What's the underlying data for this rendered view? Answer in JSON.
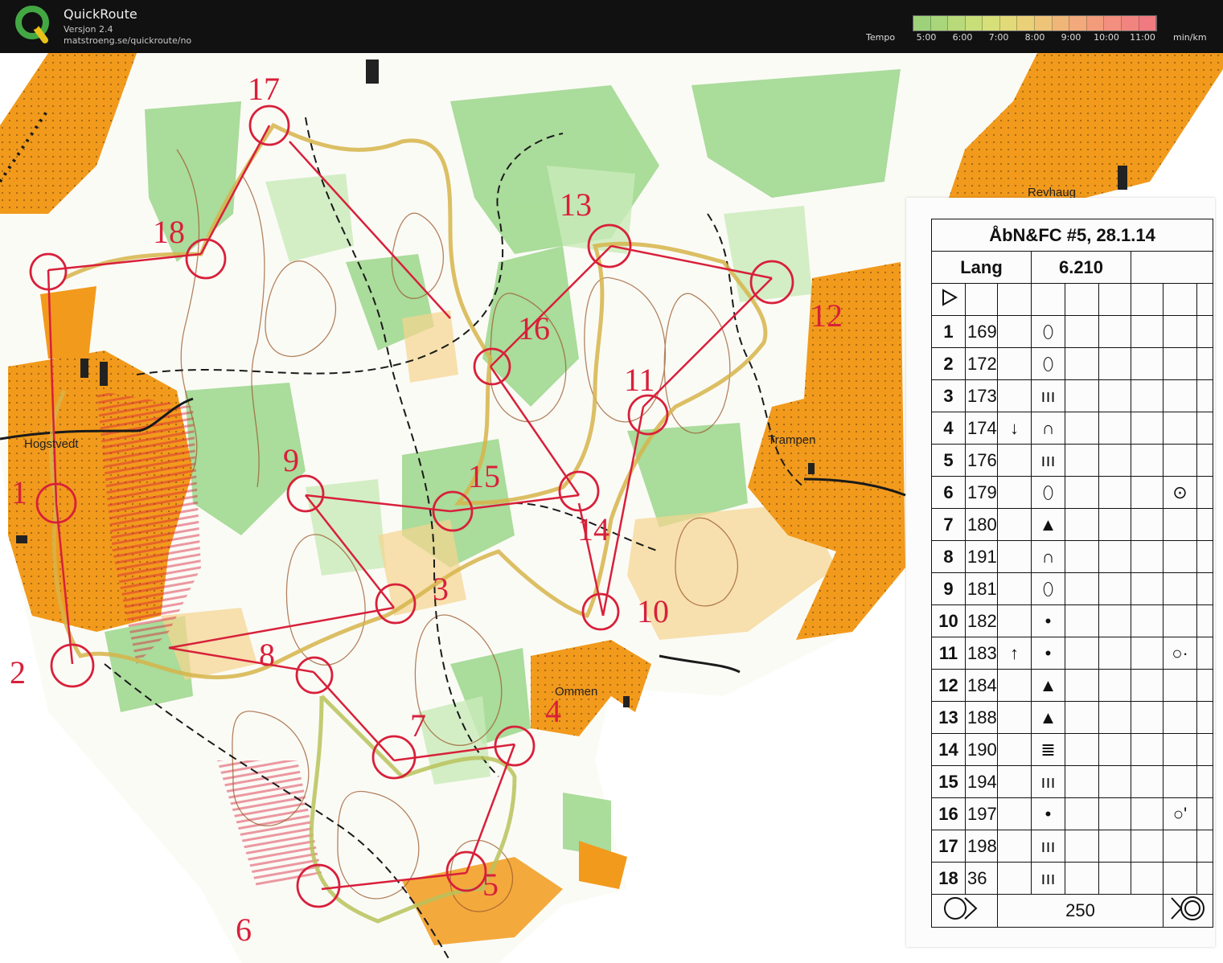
{
  "header": {
    "app_title": "QuickRoute",
    "version": "Versjon 2.4",
    "url": "matstroeng.se/quickroute/no",
    "tempo_label": "Tempo",
    "scale_ticks": [
      "5:00",
      "6:00",
      "7:00",
      "8:00",
      "9:00",
      "10:00",
      "11:00"
    ],
    "unit": "min/km",
    "scale_colors": [
      "#9ed27a",
      "#a9d67a",
      "#b8da7a",
      "#c8de78",
      "#d6e078",
      "#e2d978",
      "#ead078",
      "#eec478",
      "#f0b679",
      "#f2a97b",
      "#f39c7c",
      "#f38f7e",
      "#f2847f",
      "#f07a80"
    ]
  },
  "map": {
    "places": [
      "Revhaug",
      "Trampen",
      "Hogstvedt",
      "Ommen"
    ],
    "control_numbers": [
      "1",
      "2",
      "3",
      "4",
      "5",
      "6",
      "7",
      "8",
      "9",
      "10",
      "11",
      "12",
      "13",
      "14",
      "15",
      "16",
      "17",
      "18"
    ],
    "colors": {
      "open_land": "#f29a1c",
      "forest_green": "#8fd27c",
      "course": "#d8203a",
      "route": "#e0c060"
    }
  },
  "description": {
    "title": "ÅbN&FC #5, 28.1.14",
    "class_name": "Lang",
    "distance": "6.210",
    "start_symbol": "triangle",
    "rows": [
      {
        "num": "1",
        "code": "169",
        "arrow": "",
        "feature": "⬯",
        "extra": ""
      },
      {
        "num": "2",
        "code": "172",
        "arrow": "",
        "feature": "⬯",
        "extra": ""
      },
      {
        "num": "3",
        "code": "173",
        "arrow": "",
        "feature": "ııı",
        "extra": ""
      },
      {
        "num": "4",
        "code": "174",
        "arrow": "↓",
        "feature": "∩",
        "extra": ""
      },
      {
        "num": "5",
        "code": "176",
        "arrow": "",
        "feature": "ııı",
        "extra": ""
      },
      {
        "num": "6",
        "code": "179",
        "arrow": "",
        "feature": "⬯",
        "extra": "⊙"
      },
      {
        "num": "7",
        "code": "180",
        "arrow": "",
        "feature": "▲",
        "extra": ""
      },
      {
        "num": "8",
        "code": "191",
        "arrow": "",
        "feature": "∩",
        "extra": ""
      },
      {
        "num": "9",
        "code": "181",
        "arrow": "",
        "feature": "⬯",
        "extra": ""
      },
      {
        "num": "10",
        "code": "182",
        "arrow": "",
        "feature": "•",
        "extra": ""
      },
      {
        "num": "11",
        "code": "183",
        "arrow": "↑",
        "feature": "•",
        "extra": "○·"
      },
      {
        "num": "12",
        "code": "184",
        "arrow": "",
        "feature": "▲",
        "extra": ""
      },
      {
        "num": "13",
        "code": "188",
        "arrow": "",
        "feature": "▲",
        "extra": ""
      },
      {
        "num": "14",
        "code": "190",
        "arrow": "",
        "feature": "≣",
        "extra": ""
      },
      {
        "num": "15",
        "code": "194",
        "arrow": "",
        "feature": "ııı",
        "extra": ""
      },
      {
        "num": "16",
        "code": "197",
        "arrow": "",
        "feature": "•",
        "extra": "○'"
      },
      {
        "num": "17",
        "code": "198",
        "arrow": "",
        "feature": "ııı",
        "extra": ""
      },
      {
        "num": "18",
        "code": "36",
        "arrow": "",
        "feature": "ııı",
        "extra": ""
      }
    ],
    "finish_distance": "250"
  }
}
